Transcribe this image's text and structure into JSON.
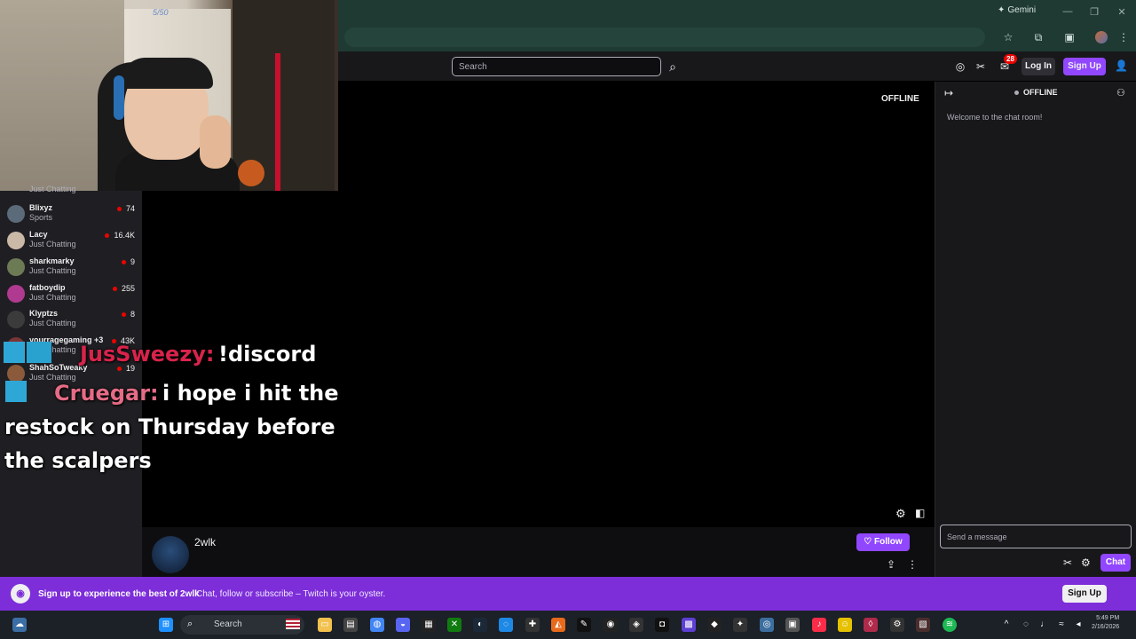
{
  "browser": {
    "gemini_label": "Gemini",
    "window_controls": [
      "—",
      "❐",
      "✕"
    ]
  },
  "nav": {
    "search_placeholder": "Search",
    "notification_count": "28",
    "login_label": "Log In",
    "signup_label": "Sign Up"
  },
  "webcam": {
    "watermark": "5/50"
  },
  "sidebar": {
    "partial_top": "Just Chatting",
    "channels": [
      {
        "name": "Blixyz",
        "category": "Sports",
        "viewers": "74",
        "color": "#5b6b7a"
      },
      {
        "name": "Lacy",
        "category": "Just Chatting",
        "viewers": "16.4K",
        "color": "#c9b9a6"
      },
      {
        "name": "sharkmarky",
        "category": "Just Chatting",
        "viewers": "9",
        "color": "#6d7b55"
      },
      {
        "name": "fatboydip",
        "category": "Just Chatting",
        "viewers": "255",
        "color": "#b03a8f"
      },
      {
        "name": "Klyptzs",
        "category": "Just Chatting",
        "viewers": "8",
        "color": "#3b3b3b"
      },
      {
        "name": "yourragegaming +3",
        "category": "Just Chatting",
        "viewers": "43K",
        "color": "#7a3535"
      },
      {
        "name": "ShahSoTweaky",
        "category": "Just Chatting",
        "viewers": "19",
        "color": "#8a5a3a"
      }
    ]
  },
  "chat_overlay": {
    "line1_name": "JusSweezy:",
    "line1_msg": "!discord",
    "line2_name": "Cruegar:",
    "line2_msg": "i hope i hit the",
    "line3": "restock on Thursday before",
    "line4": "the scalpers"
  },
  "player": {
    "status": "OFFLINE"
  },
  "channel": {
    "name": "2wlk",
    "follow_label": "Follow"
  },
  "chat": {
    "status": "OFFLINE",
    "welcome": "Welcome to the chat room!",
    "input_placeholder": "Send a message",
    "chat_button": "Chat"
  },
  "banner": {
    "headline": "Sign up to experience the best of 2wlk",
    "sub": "Chat, follow or subscribe – Twitch is your oyster.",
    "signup_label": "Sign Up"
  },
  "taskbar": {
    "search_label": "Search",
    "time": "5:49 PM",
    "date": "2/16/2026"
  }
}
